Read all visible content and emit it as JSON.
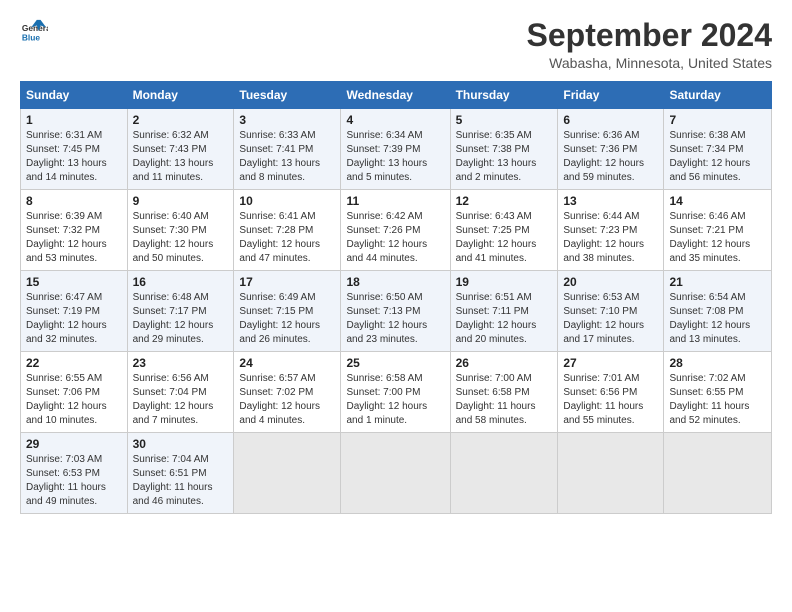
{
  "logo": {
    "line1": "General",
    "line2": "Blue"
  },
  "title": "September 2024",
  "location": "Wabasha, Minnesota, United States",
  "days_of_week": [
    "Sunday",
    "Monday",
    "Tuesday",
    "Wednesday",
    "Thursday",
    "Friday",
    "Saturday"
  ],
  "weeks": [
    [
      {
        "day": "1",
        "sunrise": "6:31 AM",
        "sunset": "7:45 PM",
        "daylight": "13 hours and 14 minutes."
      },
      {
        "day": "2",
        "sunrise": "6:32 AM",
        "sunset": "7:43 PM",
        "daylight": "13 hours and 11 minutes."
      },
      {
        "day": "3",
        "sunrise": "6:33 AM",
        "sunset": "7:41 PM",
        "daylight": "13 hours and 8 minutes."
      },
      {
        "day": "4",
        "sunrise": "6:34 AM",
        "sunset": "7:39 PM",
        "daylight": "13 hours and 5 minutes."
      },
      {
        "day": "5",
        "sunrise": "6:35 AM",
        "sunset": "7:38 PM",
        "daylight": "13 hours and 2 minutes."
      },
      {
        "day": "6",
        "sunrise": "6:36 AM",
        "sunset": "7:36 PM",
        "daylight": "12 hours and 59 minutes."
      },
      {
        "day": "7",
        "sunrise": "6:38 AM",
        "sunset": "7:34 PM",
        "daylight": "12 hours and 56 minutes."
      }
    ],
    [
      {
        "day": "8",
        "sunrise": "6:39 AM",
        "sunset": "7:32 PM",
        "daylight": "12 hours and 53 minutes."
      },
      {
        "day": "9",
        "sunrise": "6:40 AM",
        "sunset": "7:30 PM",
        "daylight": "12 hours and 50 minutes."
      },
      {
        "day": "10",
        "sunrise": "6:41 AM",
        "sunset": "7:28 PM",
        "daylight": "12 hours and 47 minutes."
      },
      {
        "day": "11",
        "sunrise": "6:42 AM",
        "sunset": "7:26 PM",
        "daylight": "12 hours and 44 minutes."
      },
      {
        "day": "12",
        "sunrise": "6:43 AM",
        "sunset": "7:25 PM",
        "daylight": "12 hours and 41 minutes."
      },
      {
        "day": "13",
        "sunrise": "6:44 AM",
        "sunset": "7:23 PM",
        "daylight": "12 hours and 38 minutes."
      },
      {
        "day": "14",
        "sunrise": "6:46 AM",
        "sunset": "7:21 PM",
        "daylight": "12 hours and 35 minutes."
      }
    ],
    [
      {
        "day": "15",
        "sunrise": "6:47 AM",
        "sunset": "7:19 PM",
        "daylight": "12 hours and 32 minutes."
      },
      {
        "day": "16",
        "sunrise": "6:48 AM",
        "sunset": "7:17 PM",
        "daylight": "12 hours and 29 minutes."
      },
      {
        "day": "17",
        "sunrise": "6:49 AM",
        "sunset": "7:15 PM",
        "daylight": "12 hours and 26 minutes."
      },
      {
        "day": "18",
        "sunrise": "6:50 AM",
        "sunset": "7:13 PM",
        "daylight": "12 hours and 23 minutes."
      },
      {
        "day": "19",
        "sunrise": "6:51 AM",
        "sunset": "7:11 PM",
        "daylight": "12 hours and 20 minutes."
      },
      {
        "day": "20",
        "sunrise": "6:53 AM",
        "sunset": "7:10 PM",
        "daylight": "12 hours and 17 minutes."
      },
      {
        "day": "21",
        "sunrise": "6:54 AM",
        "sunset": "7:08 PM",
        "daylight": "12 hours and 13 minutes."
      }
    ],
    [
      {
        "day": "22",
        "sunrise": "6:55 AM",
        "sunset": "7:06 PM",
        "daylight": "12 hours and 10 minutes."
      },
      {
        "day": "23",
        "sunrise": "6:56 AM",
        "sunset": "7:04 PM",
        "daylight": "12 hours and 7 minutes."
      },
      {
        "day": "24",
        "sunrise": "6:57 AM",
        "sunset": "7:02 PM",
        "daylight": "12 hours and 4 minutes."
      },
      {
        "day": "25",
        "sunrise": "6:58 AM",
        "sunset": "7:00 PM",
        "daylight": "12 hours and 1 minute."
      },
      {
        "day": "26",
        "sunrise": "7:00 AM",
        "sunset": "6:58 PM",
        "daylight": "11 hours and 58 minutes."
      },
      {
        "day": "27",
        "sunrise": "7:01 AM",
        "sunset": "6:56 PM",
        "daylight": "11 hours and 55 minutes."
      },
      {
        "day": "28",
        "sunrise": "7:02 AM",
        "sunset": "6:55 PM",
        "daylight": "11 hours and 52 minutes."
      }
    ],
    [
      {
        "day": "29",
        "sunrise": "7:03 AM",
        "sunset": "6:53 PM",
        "daylight": "11 hours and 49 minutes."
      },
      {
        "day": "30",
        "sunrise": "7:04 AM",
        "sunset": "6:51 PM",
        "daylight": "11 hours and 46 minutes."
      },
      null,
      null,
      null,
      null,
      null
    ]
  ],
  "labels": {
    "sunrise": "Sunrise:",
    "sunset": "Sunset:",
    "daylight": "Daylight:"
  }
}
